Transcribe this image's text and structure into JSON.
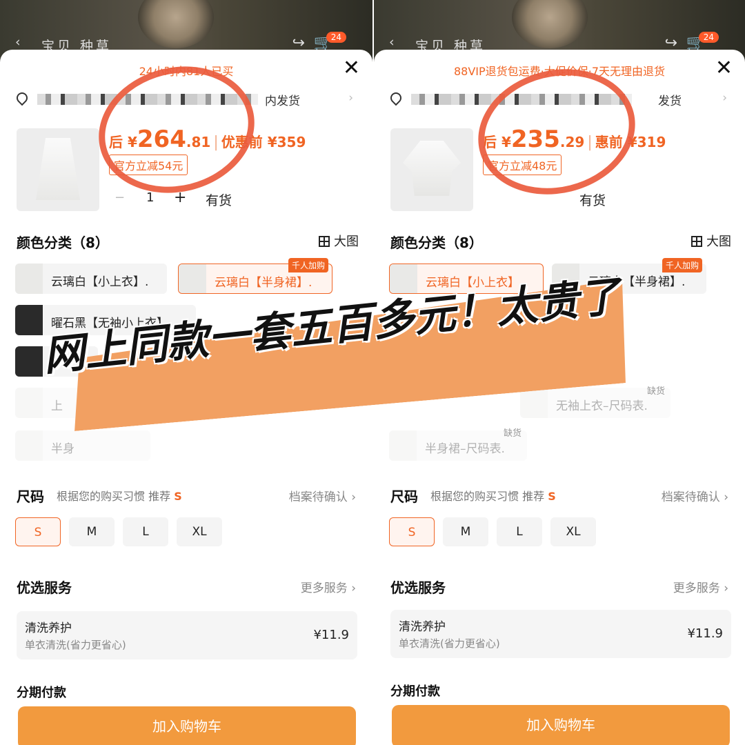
{
  "accent": "#f06423",
  "banner": "网上同款一套五百多元！太贵了",
  "phones": [
    {
      "topbar": {
        "nav": "宝贝 种草",
        "badge": "24"
      },
      "promo": "24小时内81人已买",
      "address_suffix": "内发货",
      "price": {
        "prefix": "后 ¥",
        "int": "264",
        "cents": ".81",
        "before_label": "优惠前 ¥359"
      },
      "discount": "官方立减54元",
      "qty": "1",
      "stock": "有货",
      "color_title": "颜色分类（8）",
      "big_pic": "大图",
      "options": [
        "云璃白【小上衣】.",
        "云璃白【半身裙】.",
        "曜石黑【无袖小上衣】",
        "",
        "上",
        "",
        "半身"
      ],
      "tag_hot": "千人加购",
      "size_title": "尺码",
      "size_hint_pre": "根据您的购买习惯 推荐",
      "size_hint_val": "S",
      "size_link": "档案待确认 ›",
      "sizes": [
        "S",
        "M",
        "L",
        "XL"
      ],
      "service_title": "优选服务",
      "service_link": "更多服务 ›",
      "service": {
        "name": "清洗养护",
        "desc": "单衣清洗(省力更省心)",
        "price": "¥11.9"
      },
      "installment": "分期付款",
      "cart_button": "加入购物车"
    },
    {
      "topbar": {
        "nav": "宝贝 种草",
        "badge": "24"
      },
      "promo": "88VIP退货包运费·大促价保·7天无理由退货",
      "address_suffix": "发货",
      "price": {
        "prefix": "后 ¥",
        "int": "235",
        "cents": ".29",
        "before_label": "惠前 ¥319"
      },
      "discount": "官方立减48元",
      "qty": "",
      "stock": "有货",
      "color_title": "颜色分类（8）",
      "big_pic": "大图",
      "options": [
        "云璃白【小上衣】.",
        "云璃白【半身裙】.",
        "无袖上衣–尺码表.",
        "半身裙–尺码表."
      ],
      "tag_hot": "千人加购",
      "tag_out": "缺货",
      "size_title": "尺码",
      "size_hint_pre": "根据您的购买习惯 推荐",
      "size_hint_val": "S",
      "size_link": "档案待确认 ›",
      "sizes": [
        "S",
        "M",
        "L",
        "XL"
      ],
      "service_title": "优选服务",
      "service_link": "更多服务 ›",
      "service": {
        "name": "清洗养护",
        "desc": "单衣清洗(省力更省心)",
        "price": "¥11.9"
      },
      "installment": "分期付款",
      "cart_button": "加入购物车"
    }
  ]
}
